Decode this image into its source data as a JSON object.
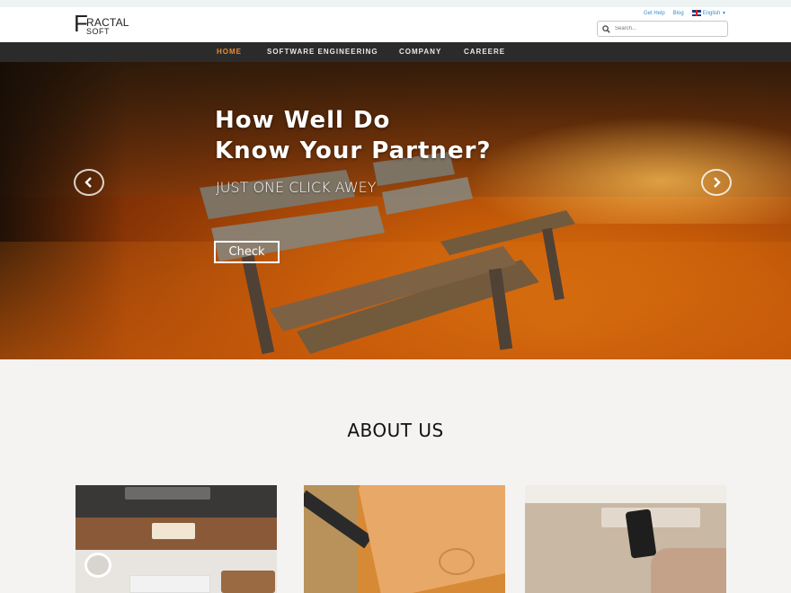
{
  "header": {
    "logo": {
      "first_letter": "F",
      "rest": "RACTAL",
      "sub": "SOFT"
    },
    "top_links": {
      "get_help": "Get Help",
      "blog": "Blog",
      "language": "English"
    },
    "search": {
      "placeholder": "Search..."
    }
  },
  "nav": {
    "items": [
      {
        "label": "HOME",
        "active": true
      },
      {
        "label": "SOFTWARE ENGINEERING",
        "active": false
      },
      {
        "label": "COMPANY",
        "active": false
      },
      {
        "label": "CAREERE",
        "active": false
      }
    ]
  },
  "hero": {
    "title": "How Well Do\nKnow Your Partner?",
    "subtitle": "JUST ONE CLICK AWEY",
    "button_label": "Check"
  },
  "about": {
    "title": "ABOUT US"
  },
  "colors": {
    "nav_bg": "#2b2b2b",
    "nav_active": "#f0892d",
    "link": "#3a8fd0",
    "page_bg": "#f4f3f1"
  }
}
